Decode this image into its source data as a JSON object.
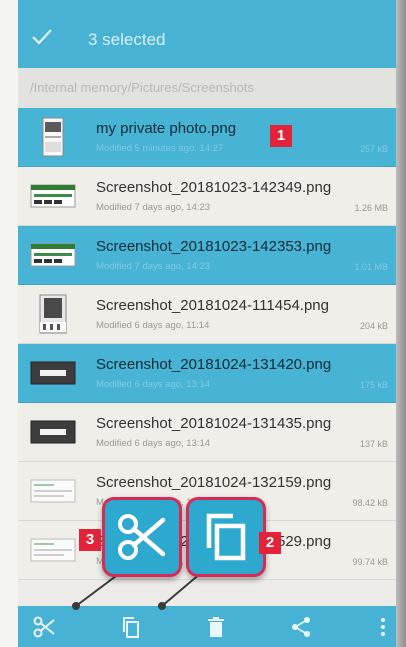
{
  "header": {
    "title": "3 selected",
    "check_icon": "checkmark-icon"
  },
  "path_bar": {
    "path": "/Internal memory/Pictures/Screenshots"
  },
  "files": [
    {
      "name": "my private photo.png",
      "meta": "Modified 5 minutes ago, 14:27",
      "size": "257 kB",
      "selected": true,
      "thumb": "portrait"
    },
    {
      "name": "Screenshot_20181023-142349.png",
      "meta": "Modified 7 days ago, 14:23",
      "size": "1.26 MB",
      "selected": false,
      "thumb": "ui"
    },
    {
      "name": "Screenshot_20181023-142353.png",
      "meta": "Modified 7 days ago, 14:23",
      "size": "1.01 MB",
      "selected": true,
      "thumb": "ui"
    },
    {
      "name": "Screenshot_20181024-111454.png",
      "meta": "Modified 6 days ago, 11:14",
      "size": "204 kB",
      "selected": false,
      "thumb": "dark-portrait"
    },
    {
      "name": "Screenshot_20181024-131420.png",
      "meta": "Modified 6 days ago, 13:14",
      "size": "175 kB",
      "selected": true,
      "thumb": "dark"
    },
    {
      "name": "Screenshot_20181024-131435.png",
      "meta": "Modified 6 days ago, 13:14",
      "size": "137 kB",
      "selected": false,
      "thumb": "dark"
    },
    {
      "name": "Screenshot_20181024-132159.png",
      "meta": "Modified 6 days ago, 13:21",
      "size": "98.42 kB",
      "selected": false,
      "thumb": "light"
    },
    {
      "name": "Screenshot_20181024-142529.png",
      "meta": "Modified 6 days ago, 14:25",
      "size": "99.74 kB",
      "selected": false,
      "thumb": "light"
    }
  ],
  "badges": {
    "one": "1",
    "two": "2",
    "three": "3"
  },
  "callouts": {
    "cut": "scissors-icon",
    "copy": "copy-icon"
  },
  "bottom_bar": [
    "scissors-icon",
    "copy-icon",
    "trash-icon",
    "share-icon",
    "more-vertical-icon"
  ],
  "colors": {
    "accent": "#47b2d3",
    "selected_row": "#48b4d5",
    "badge": "#e3233a",
    "callout_border": "#d62b54"
  }
}
